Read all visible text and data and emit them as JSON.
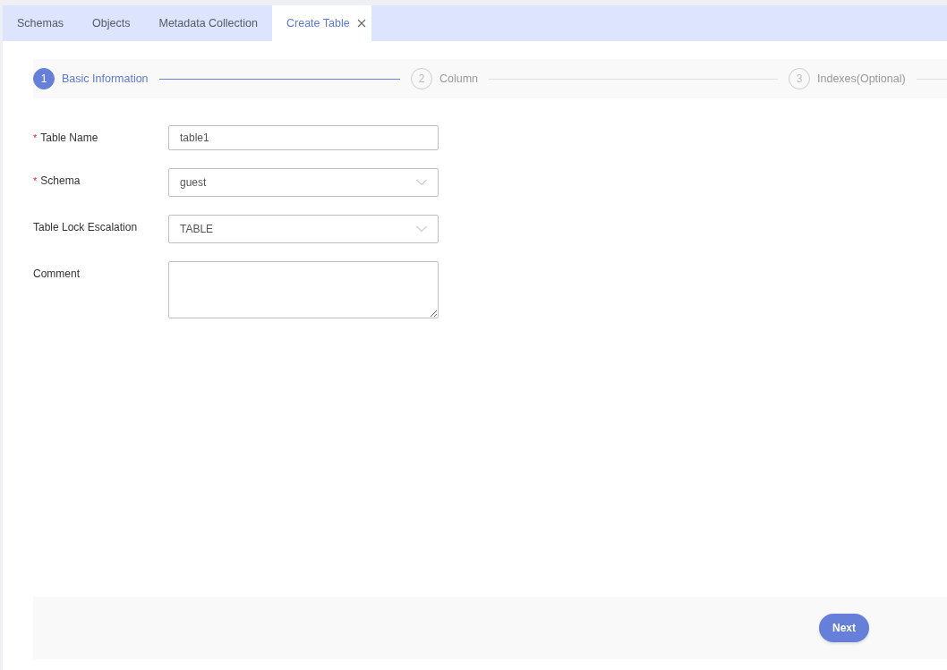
{
  "tabs": [
    {
      "label": "Schemas",
      "selected": false,
      "closable": false
    },
    {
      "label": "Objects",
      "selected": false,
      "closable": false
    },
    {
      "label": "Metadata Collection",
      "selected": false,
      "closable": false
    },
    {
      "label": "Create Table",
      "selected": true,
      "closable": true
    }
  ],
  "steps": [
    {
      "number": "1",
      "label": "Basic Information",
      "active": true
    },
    {
      "number": "2",
      "label": "Column",
      "active": false
    },
    {
      "number": "3",
      "label": "Indexes(Optional)",
      "active": false
    }
  ],
  "fields": [
    {
      "kind": "text",
      "label": "Table Name",
      "required_mark": "*",
      "value": "table1"
    },
    {
      "kind": "select",
      "label": "Schema",
      "required_mark": "*",
      "value": "guest"
    },
    {
      "kind": "select",
      "label": "Table Lock Escalation",
      "value": "TABLE"
    },
    {
      "kind": "textarea",
      "label": "Comment"
    }
  ],
  "footer": {
    "next_button": "Next"
  }
}
